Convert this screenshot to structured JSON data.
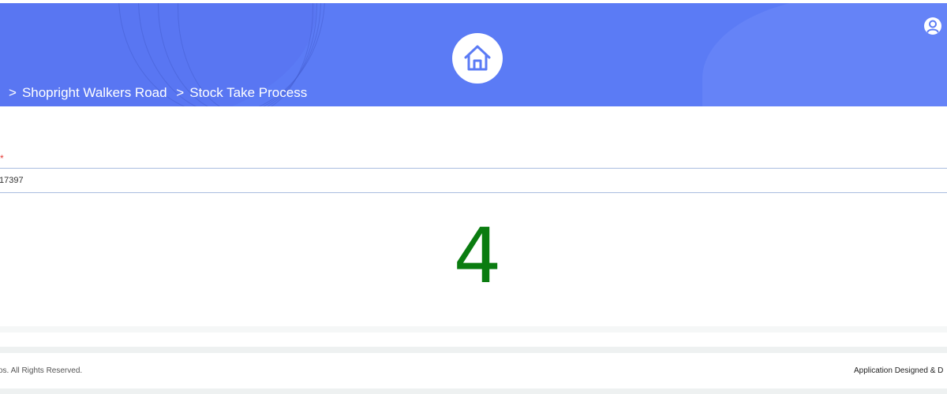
{
  "header": {
    "breadcrumb": [
      {
        "separator": ">",
        "label": "Shopright Walkers Road"
      },
      {
        "separator": ">",
        "label": "Stock Take Process"
      }
    ],
    "home_icon": "home-icon",
    "user_icon": "user-circle-icon",
    "background_color": "#5b7bf5"
  },
  "form": {
    "required_marker": "*",
    "barcode_value": "17397"
  },
  "result": {
    "count": "4",
    "color": "#0a7c10"
  },
  "footer": {
    "copyright_text": "os. All Rights Reserved.",
    "credit_text": "Application Designed & D"
  }
}
